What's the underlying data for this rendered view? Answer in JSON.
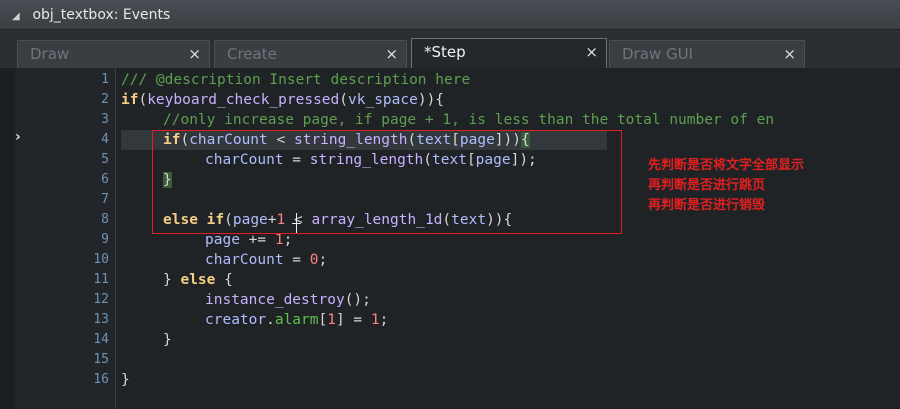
{
  "window": {
    "title": "obj_textbox: Events"
  },
  "tabs": [
    {
      "label": "Draw",
      "active": false
    },
    {
      "label": "Create",
      "active": false
    },
    {
      "label": "*Step",
      "active": true
    },
    {
      "label": "Draw GUI",
      "active": false
    }
  ],
  "tab_close_glyph": "×",
  "line_numbers": [
    "1",
    "2",
    "3",
    "4",
    "5",
    "6",
    "7",
    "8",
    "9",
    "10",
    "11",
    "12",
    "13",
    "14",
    "15",
    "16"
  ],
  "code": {
    "l1": "/// @description Insert description here",
    "l2": {
      "kw": "if",
      "p1": "(",
      "fn": "keyboard_check_pressed",
      "p2": "(",
      "arg": "vk_space",
      "p3": ")){"
    },
    "l3": "//only increase page, if page + 1, is less than the total number of en",
    "l4": {
      "kw": "if",
      "p1": "(",
      "v1": "charCount",
      "op": " < ",
      "fn": "string_length",
      "p2": "(",
      "v2": "text",
      "p3": "[",
      "v3": "page",
      "p4": "]))",
      "br": "{"
    },
    "l5": {
      "v1": "charCount",
      "op": " = ",
      "fn": "string_length",
      "p1": "(",
      "v2": "text",
      "p2": "[",
      "v3": "page",
      "p3": "]);"
    },
    "l6": {
      "br": "}"
    },
    "l8": {
      "kw1": "else",
      "kw2": "if",
      "p1": "(",
      "v1": "page",
      "op": "+",
      "n1": "1",
      "op2": " < ",
      "fn": "array_length_1d",
      "p2": "(",
      "v2": "text",
      "p3": ")){"
    },
    "l9": {
      "v1": "page",
      "op": " += ",
      "n1": "1",
      "p1": ";"
    },
    "l10": {
      "v1": "charCount",
      "op": " = ",
      "n1": "0",
      "p1": ";"
    },
    "l11": {
      "p1": "} ",
      "kw": "else",
      "p2": " {"
    },
    "l12": {
      "fn": "instance_destroy",
      "p1": "();"
    },
    "l13": {
      "v1": "creator",
      "p1": ".",
      "bi": "alarm",
      "p2": "[",
      "n1": "1",
      "p3": "] = ",
      "n2": "1",
      "p4": ";"
    },
    "l14": "}",
    "l16": "}"
  },
  "annotations": [
    "先判断是否将文字全部显示",
    "再判断是否进行跳页",
    "再判断是否进行销毁"
  ],
  "colors": {
    "keyword": "#f3ce84",
    "function": "#c8b1ff",
    "variable": "#b0bcfb",
    "comment": "#5e9f50",
    "number": "#ff8080",
    "annotation": "#e02020"
  }
}
